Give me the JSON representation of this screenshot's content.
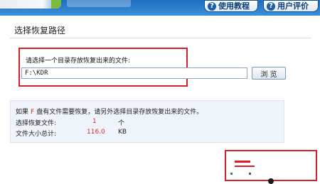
{
  "header": {
    "help_label": "使用教程",
    "review_label": "用户评价",
    "help_icon": "?",
    "review_icon": "?"
  },
  "main": {
    "section_title": "选择恢复路径",
    "prompt": "请选择一个目录存放恢复出来的文件:",
    "path_value": "F:\\KDR",
    "browse_label": "浏 览"
  },
  "info": {
    "prefix": "如果",
    "drive": "F",
    "suffix": "盘有文件需要恢复，请另外选择目录存放恢复出来的文件。",
    "selected_label": "选择恢复文件:",
    "selected_count": "1",
    "selected_unit": "个",
    "size_label": "文件大小总计:",
    "size_value": "116.0",
    "size_unit": "KB"
  },
  "colors": {
    "header_blue": "#2a7ccc",
    "highlight_red": "#d71f2b",
    "value_red": "#d72b2b"
  },
  "icons": [
    "help-icon",
    "review-icon",
    "pin-icon"
  ]
}
